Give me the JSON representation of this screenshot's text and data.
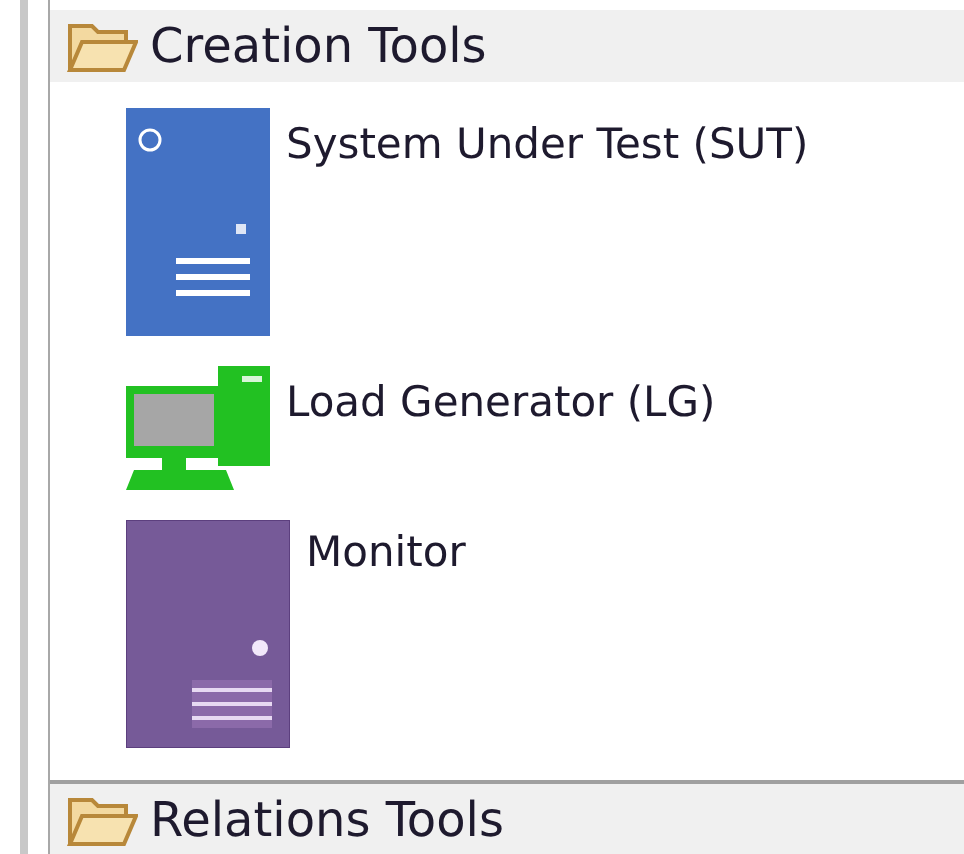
{
  "drawers": [
    {
      "title": "Creation Tools",
      "expanded": true,
      "tools": [
        {
          "label": "System Under Test (SUT)",
          "kind": "server",
          "color": "#4472c4"
        },
        {
          "label": "Load Generator (LG)",
          "kind": "desktop",
          "color": "#22c122"
        },
        {
          "label": "Monitor",
          "kind": "tower",
          "color": "#765a98"
        }
      ]
    },
    {
      "title": "Relations Tools",
      "expanded": false
    }
  ]
}
